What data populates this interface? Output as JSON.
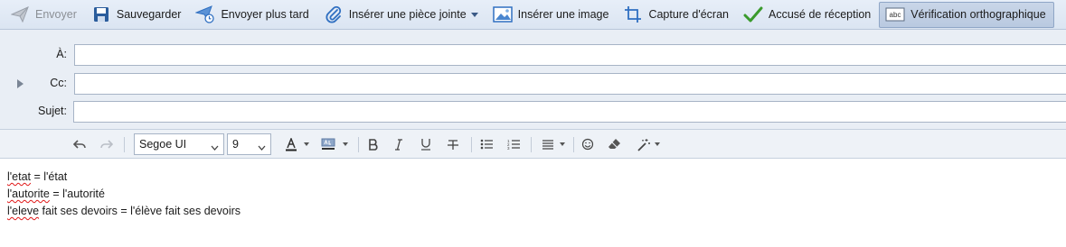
{
  "toolbar": {
    "send": "Envoyer",
    "save": "Sauvegarder",
    "send_later": "Envoyer plus tard",
    "attach": "Insérer une pièce jointe",
    "insert_image": "Insérer une image",
    "screenshot": "Capture d'écran",
    "receipt": "Accusé de réception",
    "spellcheck": "Vérification orthographique",
    "spellcheck_icon_text": "abc"
  },
  "header": {
    "to_label": "À:",
    "to_value": "",
    "cc_label": "Cc:",
    "cc_value": "",
    "subject_label": "Sujet:",
    "subject_value": ""
  },
  "format": {
    "font": "Segoe UI",
    "size": "9"
  },
  "body": {
    "lines": [
      [
        {
          "text": "l'etat",
          "misspelled": true
        },
        {
          "text": " = l'état",
          "misspelled": false
        }
      ],
      [
        {
          "text": "l'autorite",
          "misspelled": true
        },
        {
          "text": " = l'autorité",
          "misspelled": false
        }
      ],
      [
        {
          "text": "l'eleve",
          "misspelled": true
        },
        {
          "text": " fait ses devoirs = l'élève fait ses devoirs",
          "misspelled": false
        }
      ]
    ]
  },
  "colors": {
    "accent": "#2f6fc1",
    "toolbar_bg": "#dfe8f4",
    "spell_error": "#e01818",
    "check_green": "#3a9a2c"
  },
  "icons": [
    "send-icon",
    "save-icon",
    "send-later-icon",
    "paperclip-icon",
    "image-icon",
    "screenshot-icon",
    "checkmark-icon",
    "spellcheck-icon",
    "undo-icon",
    "redo-icon",
    "font-color-icon",
    "highlight-icon",
    "bold-icon",
    "italic-icon",
    "underline-icon",
    "strikethrough-icon",
    "bullet-list-icon",
    "numbered-list-icon",
    "align-icon",
    "emoji-icon",
    "clear-format-icon",
    "magic-wand-icon"
  ]
}
